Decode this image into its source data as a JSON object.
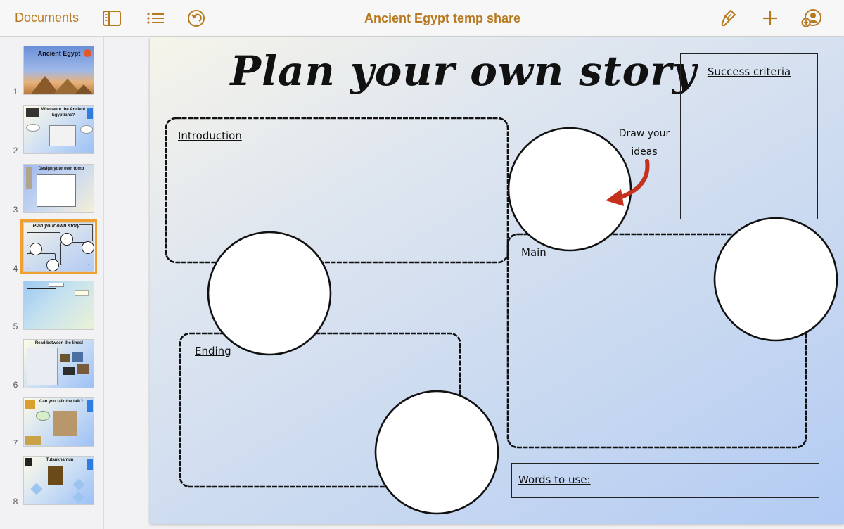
{
  "toolbar": {
    "documents_label": "Documents",
    "title": "Ancient Egypt temp share",
    "accent_color": "#b7791f"
  },
  "sidebar": {
    "slides": [
      {
        "number": "1",
        "title": "Ancient Egypt"
      },
      {
        "number": "2",
        "title": "Who were the Ancient Egyptians?"
      },
      {
        "number": "3",
        "title": "Design your own tomb"
      },
      {
        "number": "4",
        "title": "Plan your own story",
        "selected": true
      },
      {
        "number": "5",
        "title": ""
      },
      {
        "number": "6",
        "title": "Read between the lines!"
      },
      {
        "number": "7",
        "title": "Can you talk the talk?"
      },
      {
        "number": "8",
        "title": "Tutankhamun"
      }
    ]
  },
  "slide": {
    "title": "Plan your own story",
    "success_criteria": "Success criteria",
    "introduction": "Introduction",
    "main": "Main",
    "ending": "Ending",
    "draw_note": "Draw your ideas",
    "words_to_use": "Words to use:"
  }
}
